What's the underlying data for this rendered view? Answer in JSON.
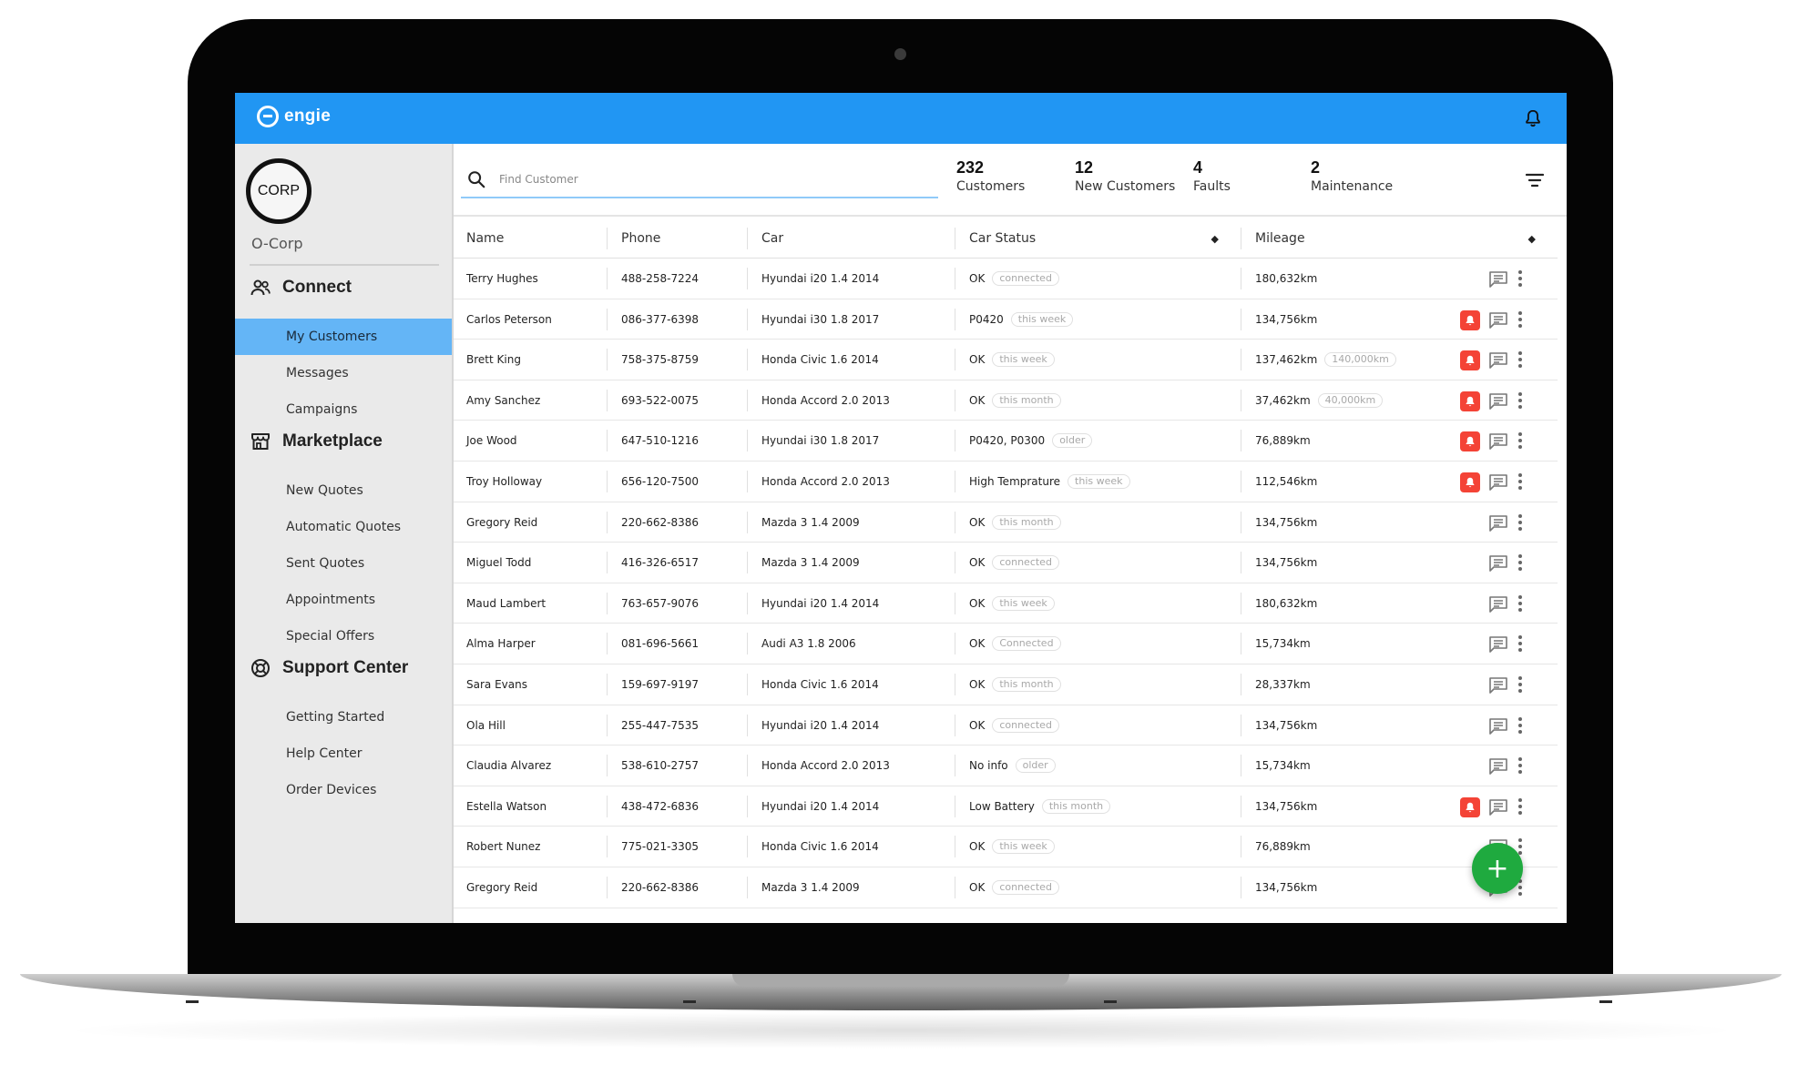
{
  "brand": {
    "name": "engie"
  },
  "sidebar": {
    "logo_text": "CORP",
    "org_name": "O-Corp",
    "sections": [
      {
        "label": "Connect",
        "icon": "people-icon",
        "items": [
          "My Customers",
          "Messages",
          "Campaigns"
        ]
      },
      {
        "label": "Marketplace",
        "icon": "store-icon",
        "items": [
          "New Quotes",
          "Automatic Quotes",
          "Sent Quotes",
          "Appointments",
          "Special Offers"
        ]
      },
      {
        "label": "Support Center",
        "icon": "lifebuoy-icon",
        "items": [
          "Getting Started",
          "Help Center",
          "Order Devices"
        ]
      }
    ],
    "active_item": "My Customers"
  },
  "search": {
    "placeholder": "Find Customer"
  },
  "stats": [
    {
      "value": "232",
      "label": "Customers"
    },
    {
      "value": "12",
      "label": "New Customers"
    },
    {
      "value": "4",
      "label": "Faults"
    },
    {
      "value": "2",
      "label": "Maintenance"
    }
  ],
  "table": {
    "columns": [
      "Name",
      "Phone",
      "Car",
      "Car Status",
      "Mileage"
    ],
    "rows": [
      {
        "name": "Terry Hughes",
        "phone": "488-258-7224",
        "car": "Hyundai i20 1.4 2014",
        "status": "OK",
        "status_badge": "connected",
        "mileage": "180,632km",
        "mileage_badge": "",
        "alert": false
      },
      {
        "name": "Carlos Peterson",
        "phone": "086-377-6398",
        "car": "Hyundai i30 1.8 2017",
        "status": "P0420",
        "status_badge": "this week",
        "mileage": "134,756km",
        "mileage_badge": "",
        "alert": true
      },
      {
        "name": "Brett King",
        "phone": "758-375-8759",
        "car": "Honda Civic 1.6 2014",
        "status": "OK",
        "status_badge": "this week",
        "mileage": "137,462km",
        "mileage_badge": "140,000km",
        "alert": true
      },
      {
        "name": "Amy Sanchez",
        "phone": "693-522-0075",
        "car": "Honda Accord 2.0 2013",
        "status": "OK",
        "status_badge": "this month",
        "mileage": "37,462km",
        "mileage_badge": "40,000km",
        "alert": true
      },
      {
        "name": "Joe Wood",
        "phone": "647-510-1216",
        "car": "Hyundai i30 1.8 2017",
        "status": "P0420, P0300",
        "status_badge": "older",
        "mileage": "76,889km",
        "mileage_badge": "",
        "alert": true
      },
      {
        "name": "Troy Holloway",
        "phone": "656-120-7500",
        "car": "Honda Accord 2.0 2013",
        "status": "High Temprature",
        "status_badge": "this week",
        "mileage": "112,546km",
        "mileage_badge": "",
        "alert": true
      },
      {
        "name": "Gregory Reid",
        "phone": "220-662-8386",
        "car": "Mazda 3 1.4 2009",
        "status": "OK",
        "status_badge": "this month",
        "mileage": "134,756km",
        "mileage_badge": "",
        "alert": false
      },
      {
        "name": "Miguel Todd",
        "phone": "416-326-6517",
        "car": "Mazda 3 1.4 2009",
        "status": "OK",
        "status_badge": "connected",
        "mileage": "134,756km",
        "mileage_badge": "",
        "alert": false
      },
      {
        "name": "Maud Lambert",
        "phone": "763-657-9076",
        "car": "Hyundai i20 1.4 2014",
        "status": "OK",
        "status_badge": "this week",
        "mileage": "180,632km",
        "mileage_badge": "",
        "alert": false
      },
      {
        "name": "Alma Harper",
        "phone": "081-696-5661",
        "car": "Audi A3 1.8 2006",
        "status": "OK",
        "status_badge": "Connected",
        "mileage": "15,734km",
        "mileage_badge": "",
        "alert": false
      },
      {
        "name": "Sara Evans",
        "phone": "159-697-9197",
        "car": "Honda Civic 1.6 2014",
        "status": "OK",
        "status_badge": "this month",
        "mileage": "28,337km",
        "mileage_badge": "",
        "alert": false
      },
      {
        "name": "Ola Hill",
        "phone": "255-447-7535",
        "car": "Hyundai i20 1.4 2014",
        "status": "OK",
        "status_badge": "connected",
        "mileage": "134,756km",
        "mileage_badge": "",
        "alert": false
      },
      {
        "name": "Claudia Alvarez",
        "phone": "538-610-2757",
        "car": "Honda Accord 2.0 2013",
        "status": "No info",
        "status_badge": "older",
        "mileage": "15,734km",
        "mileage_badge": "",
        "alert": false
      },
      {
        "name": "Estella Watson",
        "phone": "438-472-6836",
        "car": "Hyundai i20 1.4 2014",
        "status": "Low Battery",
        "status_badge": "this month",
        "mileage": "134,756km",
        "mileage_badge": "",
        "alert": true
      },
      {
        "name": "Robert Nunez",
        "phone": "775-021-3305",
        "car": "Honda Civic 1.6 2014",
        "status": "OK",
        "status_badge": "this week",
        "mileage": "76,889km",
        "mileage_badge": "",
        "alert": false
      },
      {
        "name": "Gregory Reid",
        "phone": "220-662-8386",
        "car": "Mazda 3 1.4 2009",
        "status": "OK",
        "status_badge": "connected",
        "mileage": "134,756km",
        "mileage_badge": "",
        "alert": false
      }
    ]
  },
  "fab": {
    "label": "+"
  },
  "colors": {
    "topbar": "#2196f3",
    "active_nav": "#64b5f6",
    "alert": "#f44336",
    "fab": "#1faa3f"
  }
}
